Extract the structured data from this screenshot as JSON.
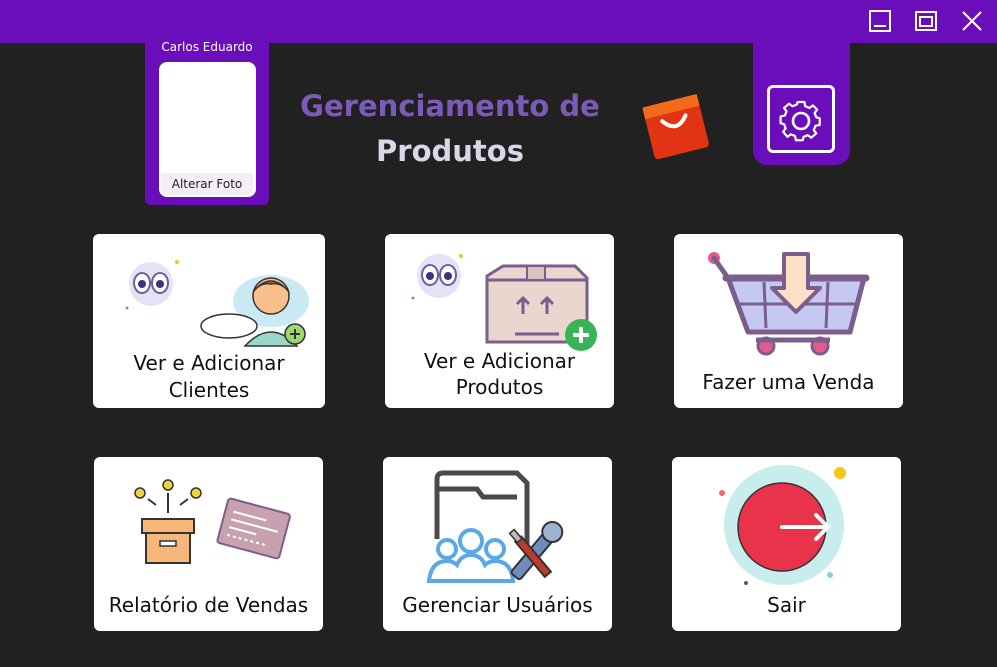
{
  "profile": {
    "name": "Carlos Eduardo",
    "change_photo_label": "Alterar Foto"
  },
  "header": {
    "title_line1": "Gerenciamento de",
    "title_line2": "Produtos"
  },
  "colors": {
    "brand_purple": "#6a0dba",
    "background": "#212121",
    "card": "#ffffff"
  },
  "cards": {
    "clients": {
      "line1": "Ver e Adicionar",
      "line2": "Clientes",
      "icon": "client-add-icon"
    },
    "products": {
      "line1": "Ver e Adicionar",
      "line2": "Produtos",
      "icon": "box-add-icon"
    },
    "sale": {
      "line1": "Fazer uma Venda",
      "icon": "cart-basket-icon"
    },
    "reports": {
      "line1": "Relatório de Vendas",
      "icon": "report-box-icon"
    },
    "users": {
      "line1": "Gerenciar Usuários",
      "icon": "users-tools-icon"
    },
    "exit": {
      "line1": "Sair",
      "icon": "exit-icon"
    }
  },
  "window_controls": [
    "minimize-icon",
    "maximize-icon",
    "close-icon"
  ]
}
